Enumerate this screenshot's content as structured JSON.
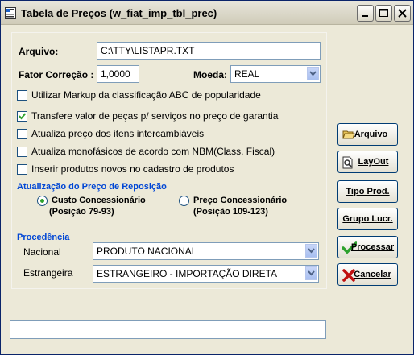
{
  "window": {
    "title": "Tabela de Preços (w_fiat_imp_tbl_prec)"
  },
  "form": {
    "arquivo_label": "Arquivo:",
    "arquivo_value": "C:\\TTY\\LISTAPR.TXT",
    "fator_label": "Fator Correção :",
    "fator_value": "1,0000",
    "moeda_label": "Moeda:",
    "moeda_value": "REAL",
    "checkboxes": [
      {
        "label": "Utilizar Markup da classificação ABC de popularidade",
        "checked": false
      },
      {
        "label": "Transfere valor de peças p/ serviços no preço de garantia",
        "checked": true
      },
      {
        "label": "Atualiza preço dos itens intercambiáveis",
        "checked": false
      },
      {
        "label": "Atualiza monofásicos de acordo com NBM(Class. Fiscal)",
        "checked": false
      },
      {
        "label": "Inserir produtos novos no cadastro de produtos",
        "checked": false
      }
    ],
    "reposicao": {
      "title": "Atualização do Preço de Reposição",
      "options": [
        {
          "label": "Custo Concessionário",
          "sub": "(Posição 79-93)",
          "selected": true
        },
        {
          "label": "Preço Concessionário",
          "sub": "(Posição 109-123)",
          "selected": false
        }
      ]
    },
    "procedencia": {
      "title": "Procedência",
      "nacional_label": "Nacional",
      "nacional_value": "PRODUTO NACIONAL",
      "estrangeira_label": "Estrangeira",
      "estrangeira_value": "ESTRANGEIRO - IMPORTAÇÃO DIRETA"
    }
  },
  "buttons": {
    "arquivo": "Arquivo",
    "layout": "LayOut",
    "tipo_prod": "Tipo Prod.",
    "grupo_lucr": "Grupo Lucr.",
    "processar": "Processar",
    "cancelar": "Cancelar"
  },
  "status": {
    "text": ""
  },
  "colors": {
    "section": "#0046d5",
    "check": "#2da12d",
    "cancel": "#c01010"
  }
}
